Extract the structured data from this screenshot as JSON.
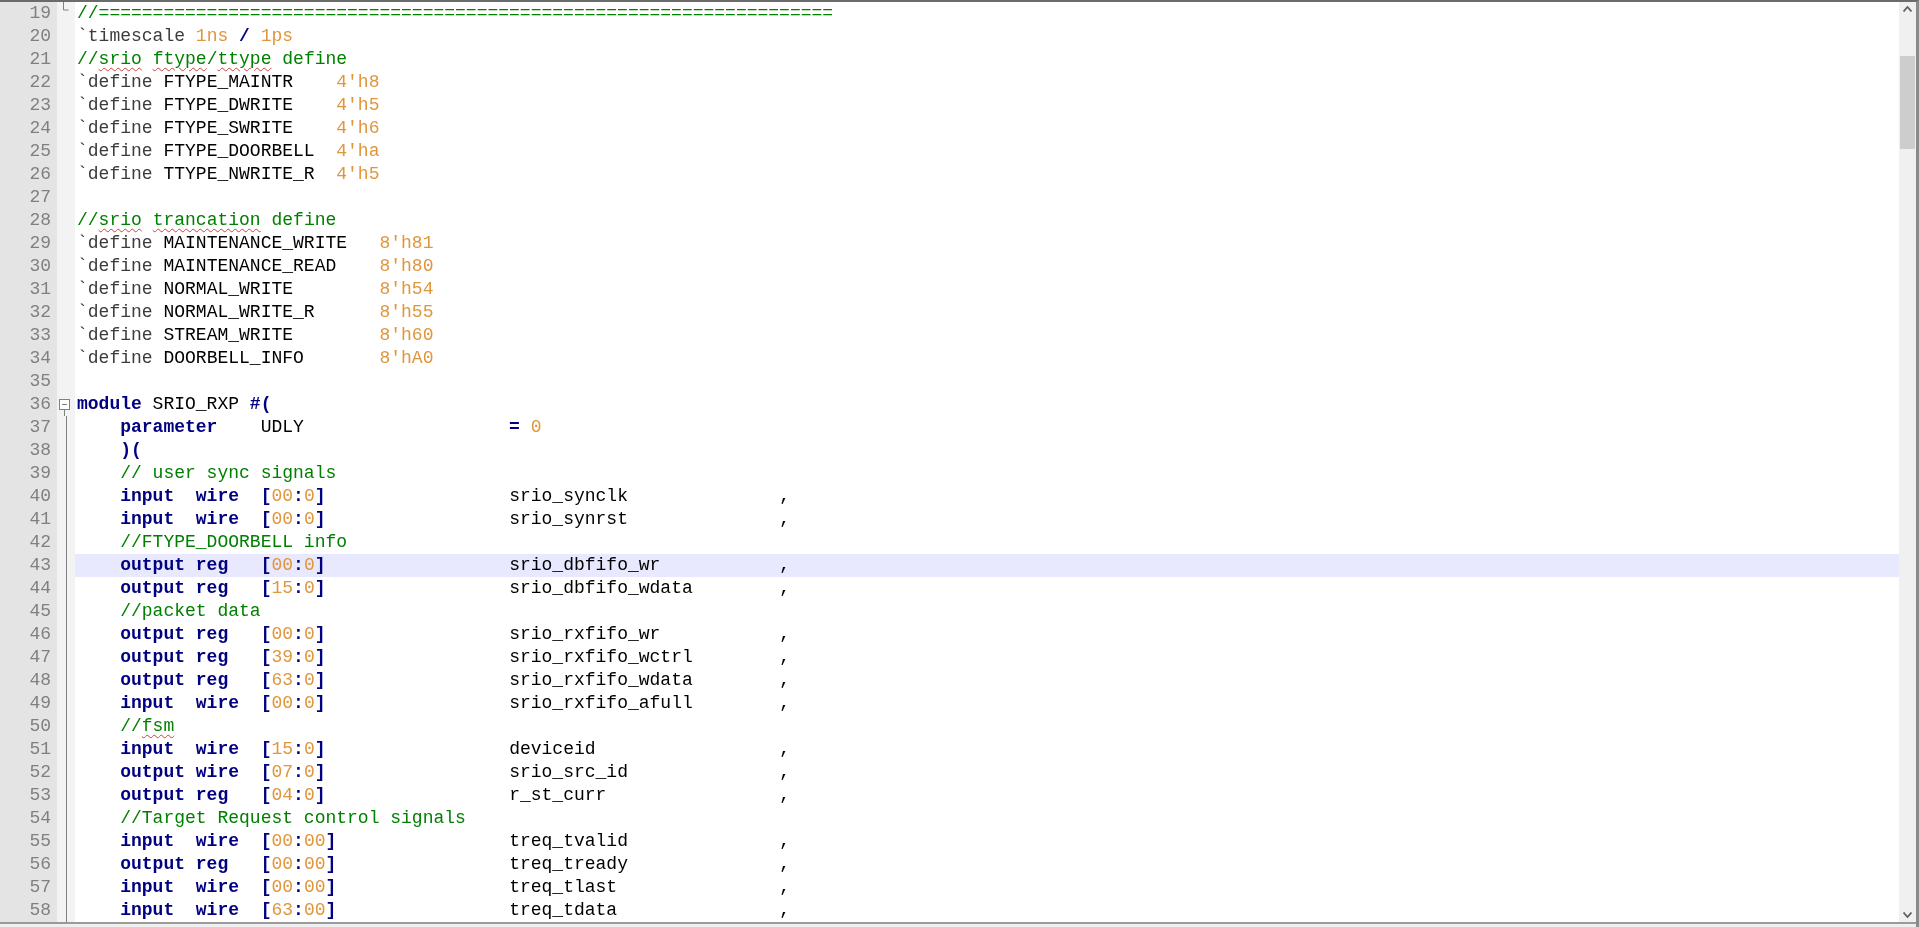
{
  "editor": {
    "lines": [
      {
        "number": "19",
        "highlighted": false,
        "fold_marker": {
          "kind": "end"
        },
        "tokens": [
          {
            "kind": "comment",
            "text": "//===================================================================="
          }
        ]
      },
      {
        "number": "20",
        "highlighted": false,
        "tokens": [
          {
            "kind": "directive",
            "text": "`timescale "
          },
          {
            "kind": "number",
            "text": "1ns"
          },
          {
            "kind": "operator",
            "text": " / "
          },
          {
            "kind": "number",
            "text": "1ps"
          }
        ]
      },
      {
        "number": "21",
        "highlighted": false,
        "tokens": [
          {
            "kind": "comment",
            "text": "//"
          },
          {
            "kind": "typo",
            "text": "srio"
          },
          {
            "kind": "typo",
            "text": " ftype"
          },
          {
            "kind": "comment",
            "text": "/"
          },
          {
            "kind": "typo",
            "text": "ttype"
          },
          {
            "kind": "comment",
            "text": " define"
          }
        ]
      },
      {
        "number": "22",
        "highlighted": false,
        "tokens": [
          {
            "kind": "directive",
            "text": "`define "
          },
          {
            "kind": "plain",
            "text": "FTYPE_MAINTR    "
          },
          {
            "kind": "number",
            "text": "4'h8"
          }
        ]
      },
      {
        "number": "23",
        "highlighted": false,
        "tokens": [
          {
            "kind": "directive",
            "text": "`define "
          },
          {
            "kind": "plain",
            "text": "FTYPE_DWRITE    "
          },
          {
            "kind": "number",
            "text": "4'h5"
          }
        ]
      },
      {
        "number": "24",
        "highlighted": false,
        "tokens": [
          {
            "kind": "directive",
            "text": "`define "
          },
          {
            "kind": "plain",
            "text": "FTYPE_SWRITE    "
          },
          {
            "kind": "number",
            "text": "4'h6"
          }
        ]
      },
      {
        "number": "25",
        "highlighted": false,
        "tokens": [
          {
            "kind": "directive",
            "text": "`define "
          },
          {
            "kind": "plain",
            "text": "FTYPE_DOORBELL  "
          },
          {
            "kind": "number",
            "text": "4'ha"
          }
        ]
      },
      {
        "number": "26",
        "highlighted": false,
        "tokens": [
          {
            "kind": "directive",
            "text": "`define "
          },
          {
            "kind": "plain",
            "text": "TTYPE_NWRITE_R  "
          },
          {
            "kind": "number",
            "text": "4'h5"
          }
        ]
      },
      {
        "number": "27",
        "highlighted": false
      },
      {
        "number": "28",
        "highlighted": false,
        "tokens": [
          {
            "kind": "comment",
            "text": "//"
          },
          {
            "kind": "typo",
            "text": "srio"
          },
          {
            "kind": "typo",
            "text": " trancation"
          },
          {
            "kind": "comment",
            "text": " define"
          }
        ]
      },
      {
        "number": "29",
        "highlighted": false,
        "tokens": [
          {
            "kind": "directive",
            "text": "`define "
          },
          {
            "kind": "plain",
            "text": "MAINTENANCE_WRITE   "
          },
          {
            "kind": "number",
            "text": "8'h81"
          }
        ]
      },
      {
        "number": "30",
        "highlighted": false,
        "tokens": [
          {
            "kind": "directive",
            "text": "`define "
          },
          {
            "kind": "plain",
            "text": "MAINTENANCE_READ    "
          },
          {
            "kind": "number",
            "text": "8'h80"
          }
        ]
      },
      {
        "number": "31",
        "highlighted": false,
        "tokens": [
          {
            "kind": "directive",
            "text": "`define "
          },
          {
            "kind": "plain",
            "text": "NORMAL_WRITE        "
          },
          {
            "kind": "number",
            "text": "8'h54"
          }
        ]
      },
      {
        "number": "32",
        "highlighted": false,
        "tokens": [
          {
            "kind": "directive",
            "text": "`define "
          },
          {
            "kind": "plain",
            "text": "NORMAL_WRITE_R      "
          },
          {
            "kind": "number",
            "text": "8'h55"
          }
        ]
      },
      {
        "number": "33",
        "highlighted": false,
        "tokens": [
          {
            "kind": "directive",
            "text": "`define "
          },
          {
            "kind": "plain",
            "text": "STREAM_WRITE        "
          },
          {
            "kind": "number",
            "text": "8'h60"
          }
        ]
      },
      {
        "number": "34",
        "highlighted": false,
        "tokens": [
          {
            "kind": "directive",
            "text": "`define "
          },
          {
            "kind": "plain",
            "text": "DOORBELL_INFO       "
          },
          {
            "kind": "number",
            "text": "8'hA0"
          }
        ]
      },
      {
        "number": "35",
        "highlighted": false
      },
      {
        "number": "36",
        "highlighted": false,
        "fold_marker": {
          "kind": "start"
        },
        "tokens": [
          {
            "kind": "keyword",
            "text": "module"
          },
          {
            "kind": "plain",
            "text": " SRIO_RXP "
          },
          {
            "kind": "operator",
            "text": "#("
          }
        ]
      },
      {
        "number": "37",
        "highlighted": false,
        "fold_marker": {
          "kind": "line"
        },
        "tokens": [
          {
            "kind": "keyword",
            "text": "    parameter"
          },
          {
            "kind": "plain",
            "text": "    UDLY                   "
          },
          {
            "kind": "operator",
            "text": "= "
          },
          {
            "kind": "number",
            "text": "0"
          }
        ]
      },
      {
        "number": "38",
        "highlighted": false,
        "fold_marker": {
          "kind": "line"
        },
        "tokens": [
          {
            "kind": "operator",
            "text": "    )("
          }
        ]
      },
      {
        "number": "39",
        "highlighted": false,
        "fold_marker": {
          "kind": "line"
        },
        "tokens": [
          {
            "kind": "comment",
            "text": "    // user sync signals"
          }
        ]
      },
      {
        "number": "40",
        "highlighted": false,
        "fold_marker": {
          "kind": "line"
        },
        "tokens": [
          {
            "kind": "keyword",
            "text": "    input  wire  "
          },
          {
            "kind": "operator",
            "text": "["
          },
          {
            "kind": "number",
            "text": "00"
          },
          {
            "kind": "operator",
            "text": ":"
          },
          {
            "kind": "number",
            "text": "0"
          },
          {
            "kind": "operator",
            "text": "]"
          },
          {
            "kind": "plain",
            "text": "                 srio_synclk              ,"
          }
        ]
      },
      {
        "number": "41",
        "highlighted": false,
        "fold_marker": {
          "kind": "line"
        },
        "tokens": [
          {
            "kind": "keyword",
            "text": "    input  wire  "
          },
          {
            "kind": "operator",
            "text": "["
          },
          {
            "kind": "number",
            "text": "00"
          },
          {
            "kind": "operator",
            "text": ":"
          },
          {
            "kind": "number",
            "text": "0"
          },
          {
            "kind": "operator",
            "text": "]"
          },
          {
            "kind": "plain",
            "text": "                 srio_synrst              ,"
          }
        ]
      },
      {
        "number": "42",
        "highlighted": false,
        "fold_marker": {
          "kind": "line"
        },
        "tokens": [
          {
            "kind": "comment",
            "text": "    //FTYPE_DOORBELL info"
          }
        ]
      },
      {
        "number": "43",
        "highlighted": true,
        "fold_marker": {
          "kind": "line"
        },
        "tokens": [
          {
            "kind": "keyword",
            "text": "    output reg   "
          },
          {
            "kind": "operator",
            "text": "["
          },
          {
            "kind": "number",
            "text": "00"
          },
          {
            "kind": "operator",
            "text": ":"
          },
          {
            "kind": "number",
            "text": "0"
          },
          {
            "kind": "operator",
            "text": "]"
          },
          {
            "kind": "plain",
            "text": "                 srio_dbfifo_wr           ,"
          }
        ]
      },
      {
        "number": "44",
        "highlighted": false,
        "fold_marker": {
          "kind": "line"
        },
        "tokens": [
          {
            "kind": "keyword",
            "text": "    output reg   "
          },
          {
            "kind": "operator",
            "text": "["
          },
          {
            "kind": "number",
            "text": "15"
          },
          {
            "kind": "operator",
            "text": ":"
          },
          {
            "kind": "number",
            "text": "0"
          },
          {
            "kind": "operator",
            "text": "]"
          },
          {
            "kind": "plain",
            "text": "                 srio_dbfifo_wdata        ,"
          }
        ]
      },
      {
        "number": "45",
        "highlighted": false,
        "fold_marker": {
          "kind": "line"
        },
        "tokens": [
          {
            "kind": "comment",
            "text": "    //packet data"
          }
        ]
      },
      {
        "number": "46",
        "highlighted": false,
        "fold_marker": {
          "kind": "line"
        },
        "tokens": [
          {
            "kind": "keyword",
            "text": "    output reg   "
          },
          {
            "kind": "operator",
            "text": "["
          },
          {
            "kind": "number",
            "text": "00"
          },
          {
            "kind": "operator",
            "text": ":"
          },
          {
            "kind": "number",
            "text": "0"
          },
          {
            "kind": "operator",
            "text": "]"
          },
          {
            "kind": "plain",
            "text": "                 srio_rxfifo_wr           ,"
          }
        ]
      },
      {
        "number": "47",
        "highlighted": false,
        "fold_marker": {
          "kind": "line"
        },
        "tokens": [
          {
            "kind": "keyword",
            "text": "    output reg   "
          },
          {
            "kind": "operator",
            "text": "["
          },
          {
            "kind": "number",
            "text": "39"
          },
          {
            "kind": "operator",
            "text": ":"
          },
          {
            "kind": "number",
            "text": "0"
          },
          {
            "kind": "operator",
            "text": "]"
          },
          {
            "kind": "plain",
            "text": "                 srio_rxfifo_wctrl        ,"
          }
        ]
      },
      {
        "number": "48",
        "highlighted": false,
        "fold_marker": {
          "kind": "line"
        },
        "tokens": [
          {
            "kind": "keyword",
            "text": "    output reg   "
          },
          {
            "kind": "operator",
            "text": "["
          },
          {
            "kind": "number",
            "text": "63"
          },
          {
            "kind": "operator",
            "text": ":"
          },
          {
            "kind": "number",
            "text": "0"
          },
          {
            "kind": "operator",
            "text": "]"
          },
          {
            "kind": "plain",
            "text": "                 srio_rxfifo_wdata        ,"
          }
        ]
      },
      {
        "number": "49",
        "highlighted": false,
        "fold_marker": {
          "kind": "line"
        },
        "tokens": [
          {
            "kind": "keyword",
            "text": "    input  wire  "
          },
          {
            "kind": "operator",
            "text": "["
          },
          {
            "kind": "number",
            "text": "00"
          },
          {
            "kind": "operator",
            "text": ":"
          },
          {
            "kind": "number",
            "text": "0"
          },
          {
            "kind": "operator",
            "text": "]"
          },
          {
            "kind": "plain",
            "text": "                 srio_rxfifo_afull        ,"
          }
        ]
      },
      {
        "number": "50",
        "highlighted": false,
        "fold_marker": {
          "kind": "line"
        },
        "tokens": [
          {
            "kind": "comment",
            "text": "    //"
          },
          {
            "kind": "typo",
            "text": "fsm"
          }
        ]
      },
      {
        "number": "51",
        "highlighted": false,
        "fold_marker": {
          "kind": "line"
        },
        "tokens": [
          {
            "kind": "keyword",
            "text": "    input  wire  "
          },
          {
            "kind": "operator",
            "text": "["
          },
          {
            "kind": "number",
            "text": "15"
          },
          {
            "kind": "operator",
            "text": ":"
          },
          {
            "kind": "number",
            "text": "0"
          },
          {
            "kind": "operator",
            "text": "]"
          },
          {
            "kind": "plain",
            "text": "                 deviceid                 ,"
          }
        ]
      },
      {
        "number": "52",
        "highlighted": false,
        "fold_marker": {
          "kind": "line"
        },
        "tokens": [
          {
            "kind": "keyword",
            "text": "    output wire  "
          },
          {
            "kind": "operator",
            "text": "["
          },
          {
            "kind": "number",
            "text": "07"
          },
          {
            "kind": "operator",
            "text": ":"
          },
          {
            "kind": "number",
            "text": "0"
          },
          {
            "kind": "operator",
            "text": "]"
          },
          {
            "kind": "plain",
            "text": "                 srio_src_id              ,"
          }
        ]
      },
      {
        "number": "53",
        "highlighted": false,
        "fold_marker": {
          "kind": "line"
        },
        "tokens": [
          {
            "kind": "keyword",
            "text": "    output reg   "
          },
          {
            "kind": "operator",
            "text": "["
          },
          {
            "kind": "number",
            "text": "04"
          },
          {
            "kind": "operator",
            "text": ":"
          },
          {
            "kind": "number",
            "text": "0"
          },
          {
            "kind": "operator",
            "text": "]"
          },
          {
            "kind": "plain",
            "text": "                 r_st_curr                ,"
          }
        ]
      },
      {
        "number": "54",
        "highlighted": false,
        "fold_marker": {
          "kind": "line"
        },
        "tokens": [
          {
            "kind": "comment",
            "text": "    //Target Request control signals"
          }
        ]
      },
      {
        "number": "55",
        "highlighted": false,
        "fold_marker": {
          "kind": "line"
        },
        "tokens": [
          {
            "kind": "keyword",
            "text": "    input  wire  "
          },
          {
            "kind": "operator",
            "text": "["
          },
          {
            "kind": "number",
            "text": "00"
          },
          {
            "kind": "operator",
            "text": ":"
          },
          {
            "kind": "number",
            "text": "00"
          },
          {
            "kind": "operator",
            "text": "]"
          },
          {
            "kind": "plain",
            "text": "                treq_tvalid              ,"
          }
        ]
      },
      {
        "number": "56",
        "highlighted": false,
        "fold_marker": {
          "kind": "line"
        },
        "tokens": [
          {
            "kind": "keyword",
            "text": "    output reg   "
          },
          {
            "kind": "operator",
            "text": "["
          },
          {
            "kind": "number",
            "text": "00"
          },
          {
            "kind": "operator",
            "text": ":"
          },
          {
            "kind": "number",
            "text": "00"
          },
          {
            "kind": "operator",
            "text": "]"
          },
          {
            "kind": "plain",
            "text": "                treq_tready              ,"
          }
        ]
      },
      {
        "number": "57",
        "highlighted": false,
        "fold_marker": {
          "kind": "line"
        },
        "tokens": [
          {
            "kind": "keyword",
            "text": "    input  wire  "
          },
          {
            "kind": "operator",
            "text": "["
          },
          {
            "kind": "number",
            "text": "00"
          },
          {
            "kind": "operator",
            "text": ":"
          },
          {
            "kind": "number",
            "text": "00"
          },
          {
            "kind": "operator",
            "text": "]"
          },
          {
            "kind": "plain",
            "text": "                treq_tlast               ,"
          }
        ]
      },
      {
        "number": "58",
        "highlighted": false,
        "fold_marker": {
          "kind": "line"
        },
        "tokens": [
          {
            "kind": "keyword",
            "text": "    input  wire  "
          },
          {
            "kind": "operator",
            "text": "["
          },
          {
            "kind": "number",
            "text": "63"
          },
          {
            "kind": "operator",
            "text": ":"
          },
          {
            "kind": "number",
            "text": "00"
          },
          {
            "kind": "operator",
            "text": "]"
          },
          {
            "kind": "plain",
            "text": "                treq_tdata               ,"
          }
        ]
      }
    ]
  }
}
